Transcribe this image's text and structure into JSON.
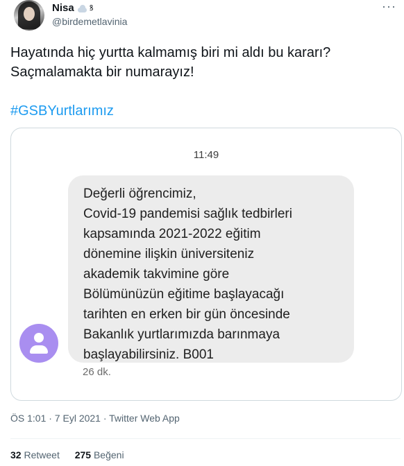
{
  "author": {
    "name": "Nisa",
    "handle": "@birdemetlavinia",
    "name_emoji_icon": "cloud-icon",
    "name_glyph": "ꝸ"
  },
  "tweet": {
    "lines": [
      "Hayatında hiç yurtta kalmamış biri mi aldı bu kararı?",
      "Saçmalamakta bir numarayız!"
    ],
    "hashtag": "#GSBYurtlarımız"
  },
  "screenshot": {
    "time": "11:49",
    "message": "Değerli öğrencimiz,\nCovid-19 pandemisi sağlık tedbirleri\nkapsamında 2021-2022 eğitim\ndönemine ilişkin üniversiteniz\nakademik takvimine göre\nBölümünüzün eğitime başlayacağı\ntarihten en erken bir gün öncesinde\nBakanlık yurtlarımızda barınmaya\nbaşlayabilirsiniz. B001",
    "age": "26 dk.",
    "avatar_color": "#a98ef0"
  },
  "meta": {
    "text": "ÖS 1:01 · 7 Eyl 2021 · Twitter Web App"
  },
  "stats": {
    "retweets": "32",
    "retweets_label": "Retweet",
    "likes": "275",
    "likes_label": "Beğeni"
  },
  "colors": {
    "link": "#1d9bf0",
    "muted": "#536471"
  }
}
